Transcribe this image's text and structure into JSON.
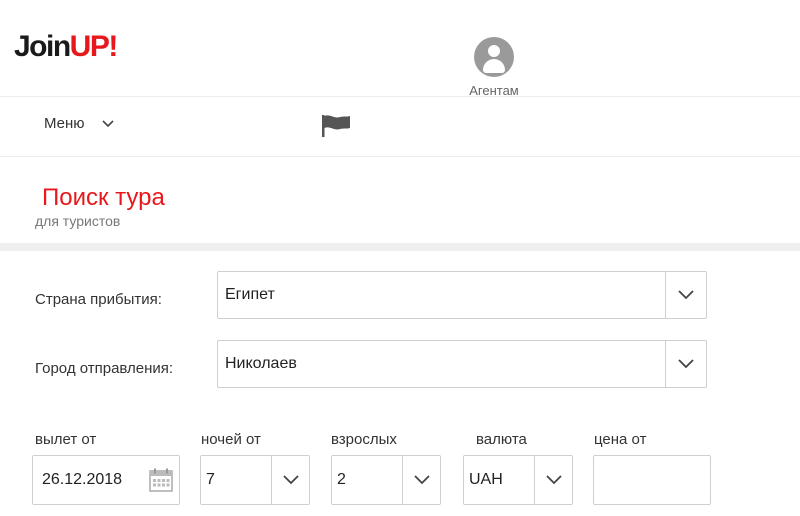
{
  "header": {
    "logo_part1": "Join",
    "logo_part2": "UP",
    "logo_part3": "!",
    "agents_label": "Агентам"
  },
  "nav": {
    "menu_label": "Меню",
    "flag_icon": "flag-icon"
  },
  "page": {
    "title": "Поиск тура",
    "subtitle": "для туристов"
  },
  "form": {
    "country": {
      "label": "Страна прибытия:",
      "value": "Египет"
    },
    "city": {
      "label": "Город отправления:",
      "value": "Николаев"
    },
    "departure": {
      "label": "вылет от",
      "value": "26.12.2018"
    },
    "nights": {
      "label": "ночей от",
      "value": "7"
    },
    "adults": {
      "label": "взрослых",
      "value": "2"
    },
    "currency": {
      "label": "валюта",
      "value": "UAH"
    },
    "price": {
      "label": "цена от",
      "value": ""
    }
  },
  "colors": {
    "brand_red": "#e8171c",
    "border": "#cfcfcf"
  }
}
